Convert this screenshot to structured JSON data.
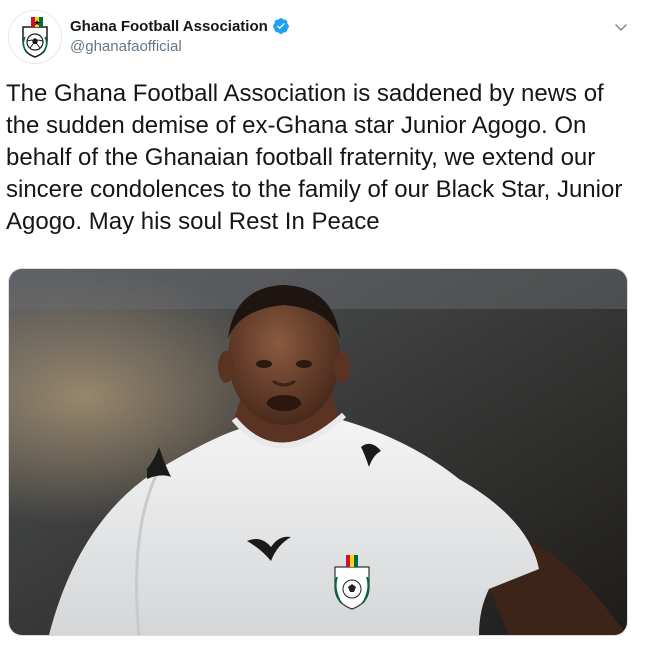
{
  "account": {
    "display_name": "Ghana Football Association",
    "handle": "@ghanafaofficial",
    "verified": true,
    "avatar_icon": "ghana-fa-crest-icon"
  },
  "tweet": {
    "text": "The Ghana Football Association is saddened by news of the sudden demise of ex-Ghana star Junior Agogo. On behalf of the Ghanaian football fraternity, we extend our sincere condolences to the family of our Black Star, Junior Agogo. May his soul Rest In Peace"
  },
  "colors": {
    "verified_blue": "#1da1f2",
    "text_primary": "#14171a",
    "text_secondary": "#657786"
  }
}
